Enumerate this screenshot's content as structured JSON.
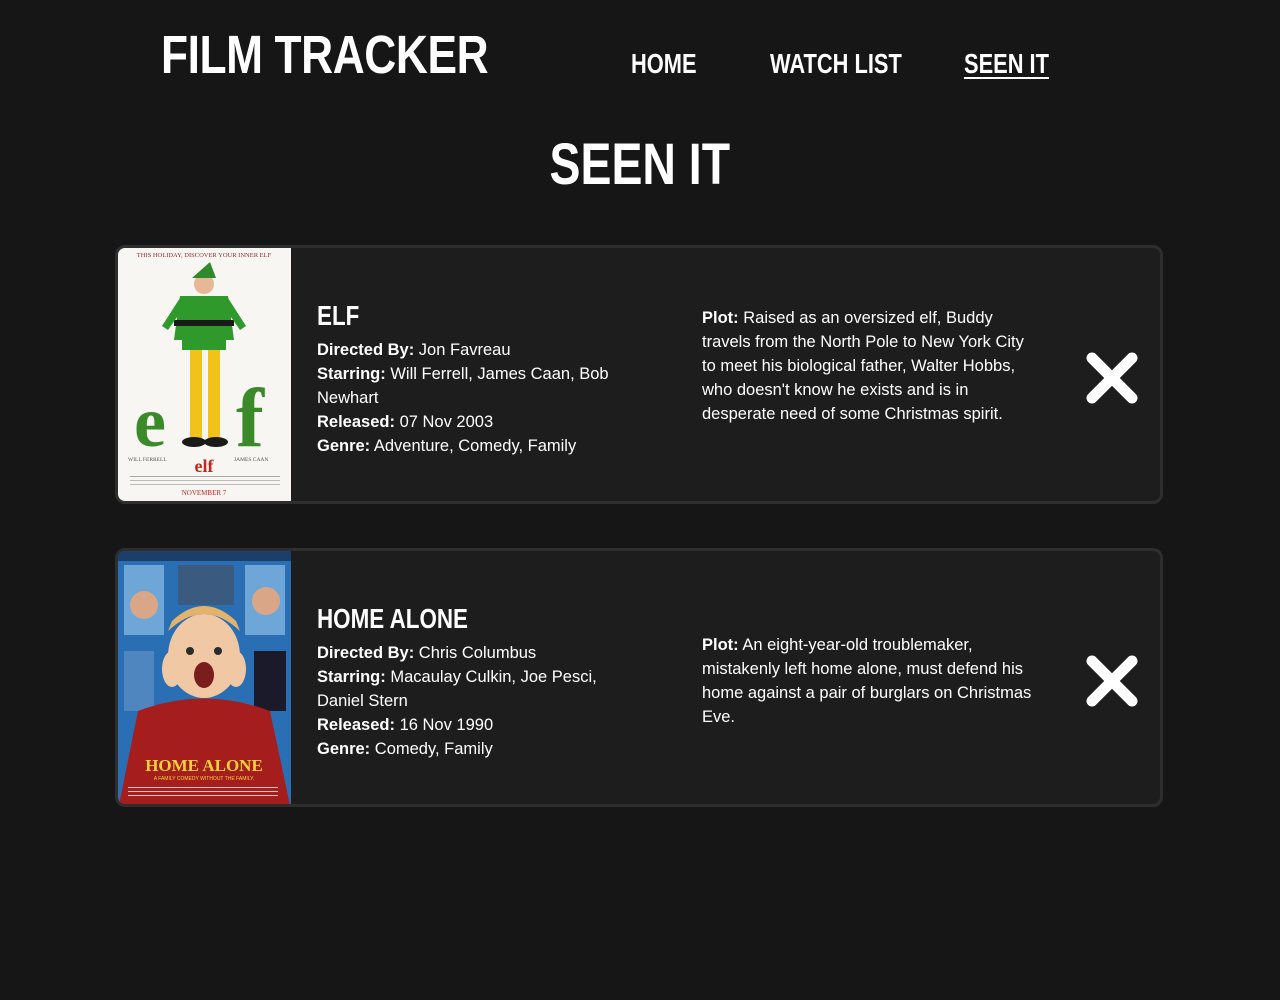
{
  "header": {
    "logo": "FILM TRACKER",
    "nav": [
      {
        "label": "HOME",
        "active": false
      },
      {
        "label": "WATCH LIST",
        "active": false
      },
      {
        "label": "SEEN IT",
        "active": true
      }
    ]
  },
  "page": {
    "title": "SEEN IT"
  },
  "labels": {
    "directed_by": "Directed By:",
    "starring": "Starring:",
    "released": "Released:",
    "genre": "Genre:",
    "plot": "Plot:"
  },
  "movies": [
    {
      "title": "ELF",
      "director": "Jon Favreau",
      "starring": "Will Ferrell, James Caan, Bob Newhart",
      "released": "07 Nov 2003",
      "genre": "Adventure, Comedy, Family",
      "plot": "Raised as an oversized elf, Buddy travels from the North Pole to New York City to meet his biological father, Walter Hobbs, who doesn't know he exists and is in desperate need of some Christmas spirit.",
      "poster": {
        "tagline": "THIS HOLIDAY, DISCOVER YOUR INNER ELF",
        "logo": "elf",
        "credit_left": "WILL FERRELL",
        "credit_right": "JAMES CAAN",
        "date": "NOVEMBER 7"
      }
    },
    {
      "title": "HOME ALONE",
      "director": "Chris Columbus",
      "starring": "Macaulay Culkin, Joe Pesci, Daniel Stern",
      "released": "16 Nov 1990",
      "genre": "Comedy, Family",
      "plot": "An eight-year-old troublemaker, mistakenly left home alone, must defend his home against a pair of burglars on Christmas Eve.",
      "poster": {
        "logo": "HOME ALONE",
        "tagline": "A FAMILY COMEDY WITHOUT THE FAMILY."
      }
    }
  ],
  "colors": {
    "background": "#161616",
    "card": "#1d1d1e",
    "card_border": "#2e2e2f",
    "text": "#ffffff"
  }
}
